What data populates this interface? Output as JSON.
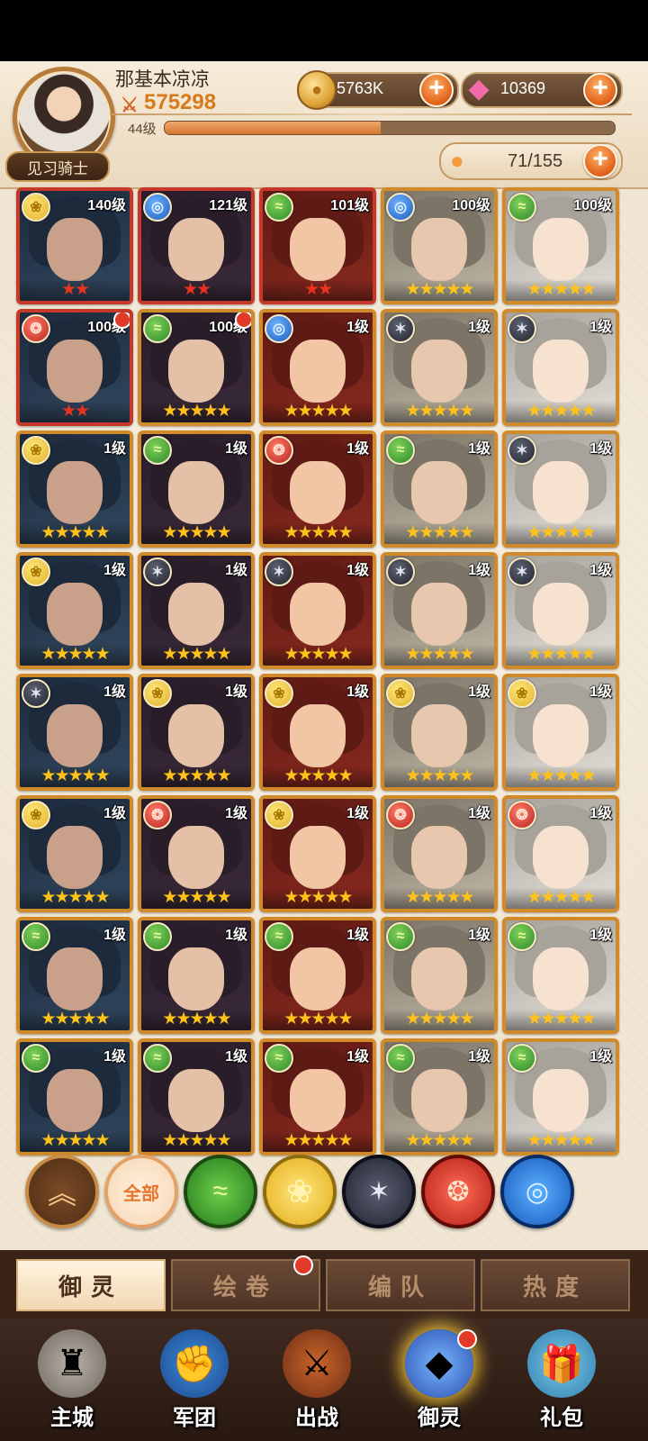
{
  "player": {
    "name": "那基本凉凉",
    "power": "575298",
    "level_label": "44级",
    "title": "见习骑士",
    "xp_fraction": 0.48
  },
  "currency": {
    "coins": "5763K",
    "gems": "10369"
  },
  "roster": {
    "count": "71/155"
  },
  "colors": {
    "frame_gold": "#d18a2a",
    "frame_red": "#c6392a",
    "accent_orange": "#e3661e",
    "tab_bg": "#3a241a"
  },
  "heroes": [
    {
      "level": "140级",
      "faction": "gold",
      "stars": 2,
      "star_color": "red",
      "frame": "red"
    },
    {
      "level": "121级",
      "faction": "blue",
      "stars": 2,
      "star_color": "red",
      "frame": "red"
    },
    {
      "level": "101级",
      "faction": "green",
      "stars": 2,
      "star_color": "red",
      "frame": "red"
    },
    {
      "level": "100级",
      "faction": "blue",
      "stars": 5,
      "star_color": "gold",
      "frame": "gold"
    },
    {
      "level": "100级",
      "faction": "green",
      "stars": 5,
      "star_color": "gold",
      "frame": "gold"
    },
    {
      "level": "100级",
      "faction": "red",
      "stars": 2,
      "star_color": "red",
      "frame": "red",
      "notify": true
    },
    {
      "level": "100级",
      "faction": "green",
      "stars": 5,
      "star_color": "gold",
      "frame": "gold",
      "notify": true
    },
    {
      "level": "1级",
      "faction": "blue",
      "stars": 5,
      "star_color": "gold",
      "frame": "gold"
    },
    {
      "level": "1级",
      "faction": "dark",
      "stars": 5,
      "star_color": "gold",
      "frame": "gold"
    },
    {
      "level": "1级",
      "faction": "dark",
      "stars": 5,
      "star_color": "gold",
      "frame": "gold"
    },
    {
      "level": "1级",
      "faction": "gold",
      "stars": 5,
      "star_color": "gold",
      "frame": "gold"
    },
    {
      "level": "1级",
      "faction": "green",
      "stars": 5,
      "star_color": "gold",
      "frame": "gold"
    },
    {
      "level": "1级",
      "faction": "red",
      "stars": 5,
      "star_color": "gold",
      "frame": "gold"
    },
    {
      "level": "1级",
      "faction": "green",
      "stars": 5,
      "star_color": "gold",
      "frame": "gold"
    },
    {
      "level": "1级",
      "faction": "dark",
      "stars": 5,
      "star_color": "gold",
      "frame": "gold"
    },
    {
      "level": "1级",
      "faction": "gold",
      "stars": 5,
      "star_color": "gold",
      "frame": "gold"
    },
    {
      "level": "1级",
      "faction": "dark",
      "stars": 5,
      "star_color": "gold",
      "frame": "gold"
    },
    {
      "level": "1级",
      "faction": "dark",
      "stars": 5,
      "star_color": "gold",
      "frame": "gold"
    },
    {
      "level": "1级",
      "faction": "dark",
      "stars": 5,
      "star_color": "gold",
      "frame": "gold"
    },
    {
      "level": "1级",
      "faction": "dark",
      "stars": 5,
      "star_color": "gold",
      "frame": "gold"
    },
    {
      "level": "1级",
      "faction": "dark",
      "stars": 5,
      "star_color": "gold",
      "frame": "gold"
    },
    {
      "level": "1级",
      "faction": "gold",
      "stars": 5,
      "star_color": "gold",
      "frame": "gold"
    },
    {
      "level": "1级",
      "faction": "gold",
      "stars": 5,
      "star_color": "gold",
      "frame": "gold"
    },
    {
      "level": "1级",
      "faction": "gold",
      "stars": 5,
      "star_color": "gold",
      "frame": "gold"
    },
    {
      "level": "1级",
      "faction": "gold",
      "stars": 5,
      "star_color": "gold",
      "frame": "gold"
    },
    {
      "level": "1级",
      "faction": "gold",
      "stars": 5,
      "star_color": "gold",
      "frame": "gold"
    },
    {
      "level": "1级",
      "faction": "red",
      "stars": 5,
      "star_color": "gold",
      "frame": "gold"
    },
    {
      "level": "1级",
      "faction": "gold",
      "stars": 5,
      "star_color": "gold",
      "frame": "gold"
    },
    {
      "level": "1级",
      "faction": "red",
      "stars": 5,
      "star_color": "gold",
      "frame": "gold"
    },
    {
      "level": "1级",
      "faction": "red",
      "stars": 5,
      "star_color": "gold",
      "frame": "gold"
    },
    {
      "level": "1级",
      "faction": "green",
      "stars": 5,
      "star_color": "gold",
      "frame": "gold"
    },
    {
      "level": "1级",
      "faction": "green",
      "stars": 5,
      "star_color": "gold",
      "frame": "gold"
    },
    {
      "level": "1级",
      "faction": "green",
      "stars": 5,
      "star_color": "gold",
      "frame": "gold"
    },
    {
      "level": "1级",
      "faction": "green",
      "stars": 5,
      "star_color": "gold",
      "frame": "gold"
    },
    {
      "level": "1级",
      "faction": "green",
      "stars": 5,
      "star_color": "gold",
      "frame": "gold"
    },
    {
      "level": "1级",
      "faction": "green",
      "stars": 5,
      "star_color": "gold",
      "frame": "gold"
    },
    {
      "level": "1级",
      "faction": "green",
      "stars": 5,
      "star_color": "gold",
      "frame": "gold"
    },
    {
      "level": "1级",
      "faction": "green",
      "stars": 5,
      "star_color": "gold",
      "frame": "gold"
    },
    {
      "level": "1级",
      "faction": "green",
      "stars": 5,
      "star_color": "gold",
      "frame": "gold"
    },
    {
      "level": "1级",
      "faction": "green",
      "stars": 5,
      "star_color": "gold",
      "frame": "gold"
    }
  ],
  "filters": [
    {
      "id": "collapse",
      "label": "",
      "icon": "double-chevron-up-icon"
    },
    {
      "id": "all",
      "label": "全部",
      "icon": ""
    },
    {
      "id": "green",
      "label": "",
      "icon": "green-faction-icon"
    },
    {
      "id": "gold",
      "label": "",
      "icon": "gold-rose-faction-icon"
    },
    {
      "id": "dark",
      "label": "",
      "icon": "dark-star-faction-icon"
    },
    {
      "id": "red",
      "label": "",
      "icon": "red-flame-faction-icon"
    },
    {
      "id": "blue",
      "label": "",
      "icon": "blue-wave-faction-icon"
    }
  ],
  "tabs": [
    {
      "label": "御灵",
      "active": true
    },
    {
      "label": "绘卷",
      "active": false,
      "notify": true
    },
    {
      "label": "编队",
      "active": false
    },
    {
      "label": "热度",
      "active": false
    }
  ],
  "nav": [
    {
      "label": "主城",
      "icon": "castle-icon"
    },
    {
      "label": "军团",
      "icon": "fist-shield-icon"
    },
    {
      "label": "出战",
      "icon": "sword-gate-icon"
    },
    {
      "label": "御灵",
      "icon": "crystal-icon",
      "active": true,
      "notify": true
    },
    {
      "label": "礼包",
      "icon": "gift-shop-icon"
    }
  ]
}
